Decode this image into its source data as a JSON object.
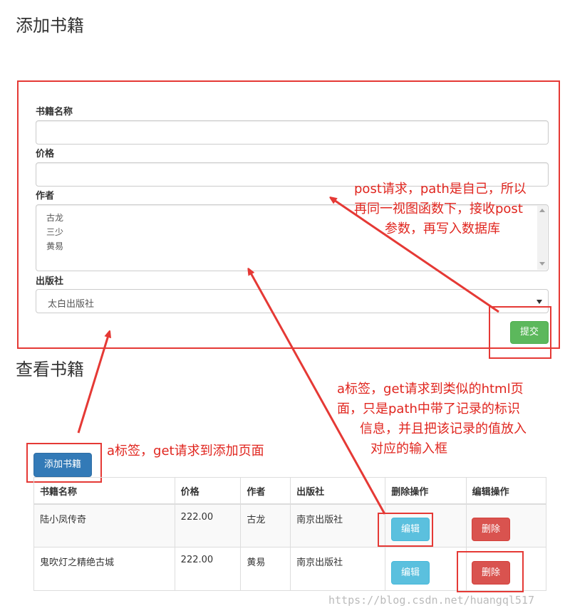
{
  "add_section": {
    "title": "添加书籍",
    "fields": {
      "book_name_label": "书籍名称",
      "price_label": "价格",
      "author_label": "作者",
      "author_options": [
        "古龙",
        "三少",
        "黄易"
      ],
      "publisher_label": "出版社",
      "publisher_selected": "太白出版社"
    },
    "submit_label": "提交"
  },
  "view_section": {
    "title": "查看书籍",
    "add_button_label": "添加书籍",
    "table": {
      "headers": [
        "书籍名称",
        "价格",
        "作者",
        "出版社",
        "删除操作",
        "编辑操作"
      ],
      "rows": [
        {
          "name": "陆小凤传奇",
          "price": "222.00",
          "author": "古龙",
          "publisher": "南京出版社",
          "edit_label": "编辑",
          "delete_label": "删除"
        },
        {
          "name": "鬼吹灯之精绝古城",
          "price": "222.00",
          "author": "黄易",
          "publisher": "南京出版社",
          "edit_label": "编辑",
          "delete_label": "删除"
        }
      ]
    }
  },
  "annotations": {
    "post_note_line1": "post请求，path是自己，所以",
    "post_note_line2": "再同一视图函数下，接收post",
    "post_note_line3": "参数，再写入数据库",
    "edit_note_line1": "a标签，get请求到类似的html页",
    "edit_note_line2": "面，只是path中带了记录的标识",
    "edit_note_line3": "信息，并且把该记录的值放入",
    "edit_note_line4": "对应的输入框",
    "add_note": "a标签，get请求到添加页面"
  },
  "watermark": "https://blog.csdn.net/huangql517",
  "colors": {
    "annotation_red": "#e0261f",
    "success": "#5cb85c",
    "primary": "#337ab7",
    "info": "#5bc0de",
    "danger": "#d9534f"
  }
}
